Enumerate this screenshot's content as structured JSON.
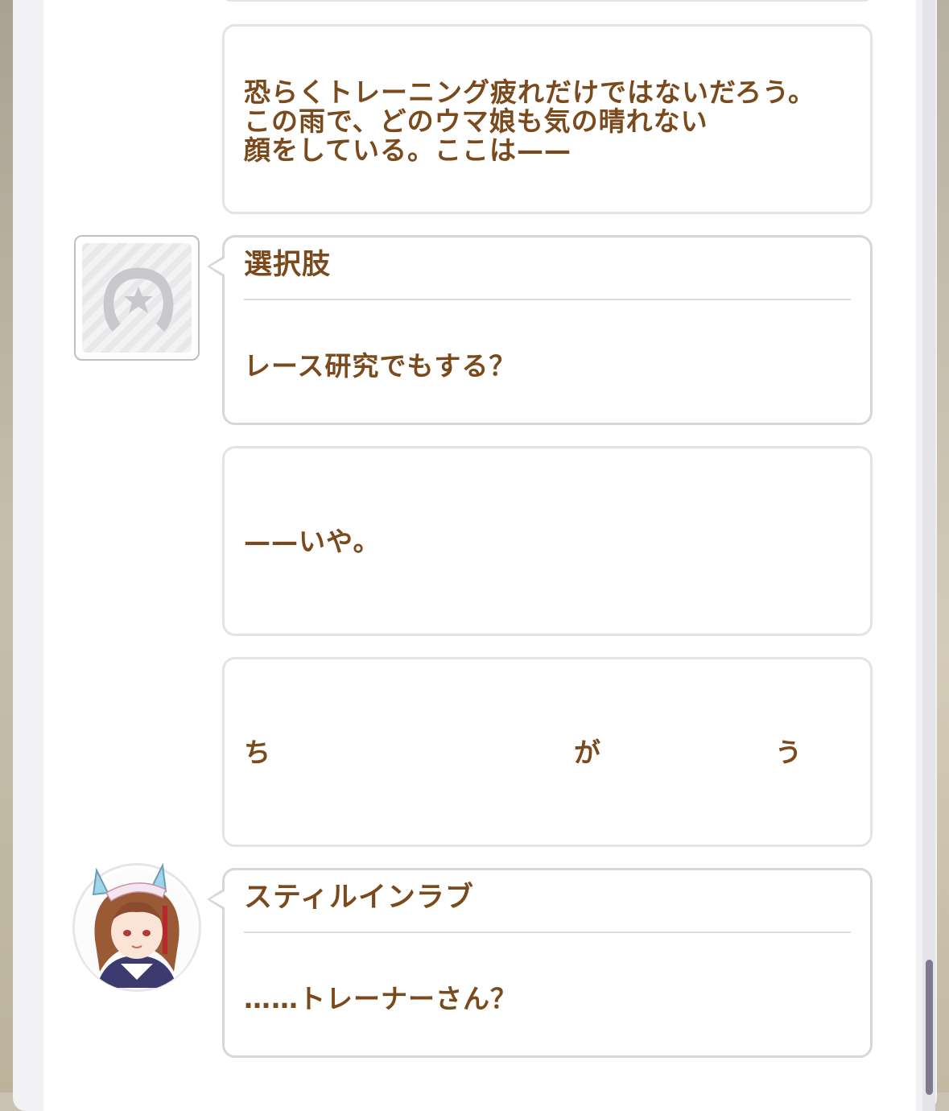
{
  "messages": [
    {
      "lines": [
        "恐らくトレーニング疲れだけではないだろう。",
        "この雨で、どのウマ娘も気の晴れない",
        "顔をしている。ここは——"
      ]
    },
    {
      "speaker": "選択肢",
      "avatar": "horseshoe-star-icon",
      "text": "レース研究でもする？"
    },
    {
      "text": "——いや。"
    },
    {
      "chars": [
        "ち",
        "が",
        "う"
      ]
    },
    {
      "speaker": "スティルインラブ",
      "avatar": "character-portrait",
      "text": "……トレーナーさん？"
    }
  ],
  "colors": {
    "text": "#7a4a1c",
    "bubble_border": "#e3e3e7",
    "scroll_thumb": "#7c7a8c"
  }
}
